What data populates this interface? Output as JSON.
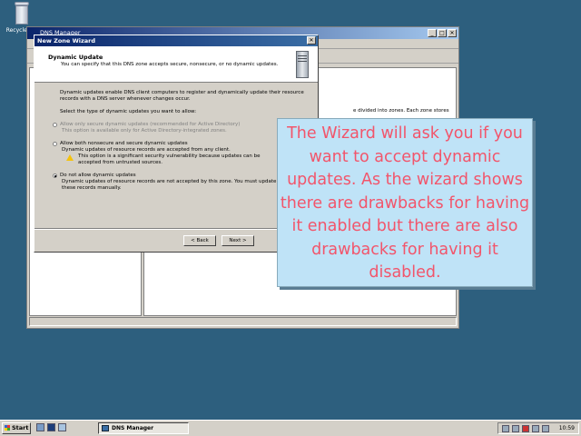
{
  "desktop": {
    "recycle_label": "Recycle Bin"
  },
  "dns_manager": {
    "title": "DNS Manager",
    "right_pane_text": "e divided into zones. Each zone stores"
  },
  "wizard": {
    "title": "New Zone Wizard",
    "header_title": "Dynamic Update",
    "header_desc": "You can specify that this DNS zone accepts secure, nonsecure, or no dynamic updates.",
    "intro": "Dynamic updates enable DNS client computers to register and dynamically update their resource records with a DNS server whenever changes occur.",
    "prompt": "Select the type of dynamic updates you want to allow:",
    "options": [
      {
        "label": "Allow only secure dynamic updates (recommended for Active Directory)",
        "desc": "This option is available only for Active Directory-integrated zones.",
        "selected": false,
        "disabled": true
      },
      {
        "label": "Allow both nonsecure and secure dynamic updates",
        "desc": "Dynamic updates of resource records are accepted from any client.",
        "warning": "This option is a significant security vulnerability because updates can be accepted from untrusted sources.",
        "selected": false,
        "disabled": false
      },
      {
        "label": "Do not allow dynamic updates",
        "desc": "Dynamic updates of resource records are not accepted by this zone. You must update these records manually.",
        "selected": true,
        "disabled": false
      }
    ],
    "back_label": "< Back",
    "next_label": "Next >"
  },
  "callout": {
    "text": "The Wizard will ask you if you want to accept dynamic updates. As the wizard shows there are drawbacks for having it enabled but there are also drawbacks for having it disabled."
  },
  "taskbar": {
    "start_label": "Start",
    "task_label": "DNS Manager",
    "clock": "10:59"
  }
}
